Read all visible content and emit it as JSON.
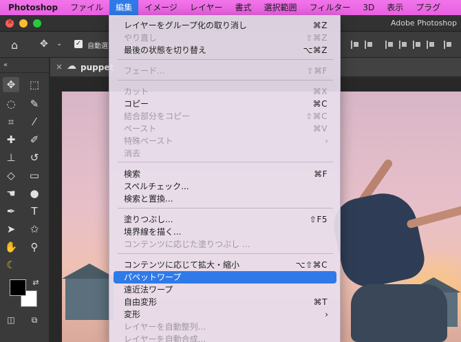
{
  "menubar": {
    "app": "Photoshop",
    "items": [
      "ファイル",
      "編集",
      "イメージ",
      "レイヤー",
      "書式",
      "選択範囲",
      "フィルター",
      "3D",
      "表示",
      "プラグ"
    ],
    "active_index": 1
  },
  "titlebar": {
    "title": "Adobe Photoshop"
  },
  "options_bar": {
    "auto_select_label": "自動選",
    "auto_select_checked": true
  },
  "document": {
    "tab_name": "puppet"
  },
  "colors": {
    "accent": "#2f7ae8",
    "menubar": "#e860e0",
    "foreground": "#000000",
    "background": "#ffffff"
  },
  "edit_menu": {
    "items": [
      {
        "label": "レイヤーをグループ化の取り消し",
        "shortcut": "⌘Z",
        "disabled": false
      },
      {
        "label": "やり直し",
        "shortcut": "⇧⌘Z",
        "disabled": true
      },
      {
        "label": "最後の状態を切り替え",
        "shortcut": "⌥⌘Z",
        "disabled": false
      },
      {
        "separator": true
      },
      {
        "label": "フェード...",
        "shortcut": "⇧⌘F",
        "disabled": true
      },
      {
        "separator": true
      },
      {
        "label": "カット",
        "shortcut": "⌘X",
        "disabled": true
      },
      {
        "label": "コピー",
        "shortcut": "⌘C",
        "disabled": false
      },
      {
        "label": "結合部分をコピー",
        "shortcut": "⇧⌘C",
        "disabled": true
      },
      {
        "label": "ペースト",
        "shortcut": "⌘V",
        "disabled": true
      },
      {
        "label": "特殊ペースト",
        "shortcut": "",
        "submenu": true,
        "disabled": true
      },
      {
        "label": "消去",
        "shortcut": "",
        "disabled": true
      },
      {
        "separator": true
      },
      {
        "label": "検索",
        "shortcut": "⌘F",
        "disabled": false
      },
      {
        "label": "スペルチェック...",
        "shortcut": "",
        "disabled": false
      },
      {
        "label": "検索と置換...",
        "shortcut": "",
        "disabled": false
      },
      {
        "separator": true
      },
      {
        "label": "塗りつぶし...",
        "shortcut": "⇧F5",
        "disabled": false
      },
      {
        "label": "境界線を描く...",
        "shortcut": "",
        "disabled": false
      },
      {
        "label": "コンテンツに応じた塗りつぶし ...",
        "shortcut": "",
        "disabled": true
      },
      {
        "separator": true
      },
      {
        "label": "コンテンツに応じて拡大・縮小",
        "shortcut": "⌥⇧⌘C",
        "disabled": false
      },
      {
        "label": "パペットワープ",
        "shortcut": "",
        "disabled": false,
        "highlight": true
      },
      {
        "label": "遠近法ワープ",
        "shortcut": "",
        "disabled": false
      },
      {
        "label": "自由変形",
        "shortcut": "⌘T",
        "disabled": false
      },
      {
        "label": "変形",
        "shortcut": "",
        "submenu": true,
        "disabled": false
      },
      {
        "label": "レイヤーを自動整列...",
        "shortcut": "",
        "disabled": true
      },
      {
        "label": "レイヤーを自動合成...",
        "shortcut": "",
        "disabled": true
      }
    ]
  }
}
